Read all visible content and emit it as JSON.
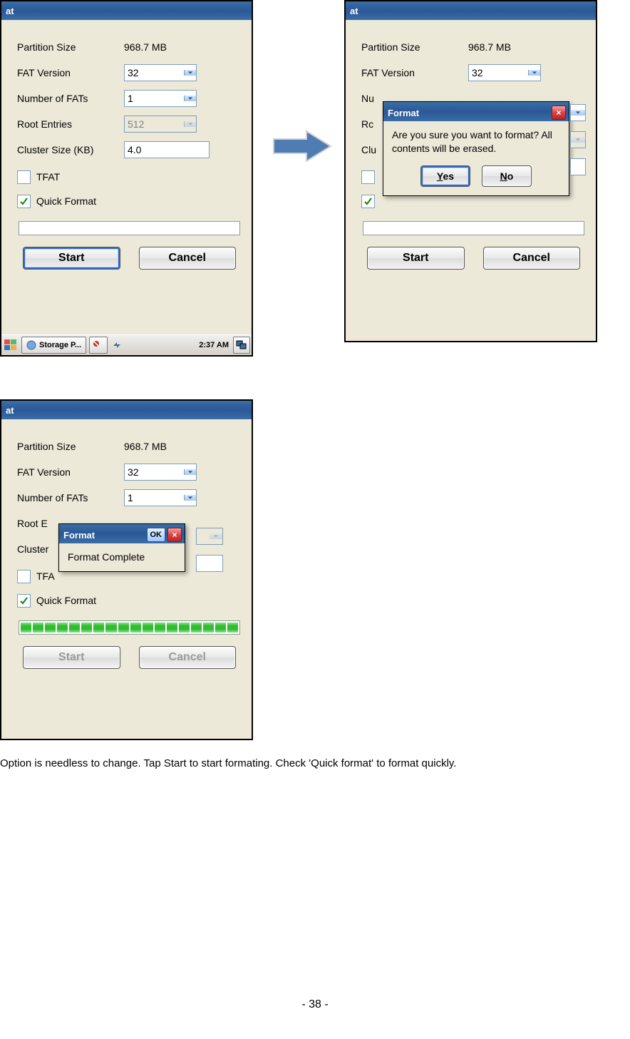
{
  "title_fragment": "at",
  "labels": {
    "partition_size": "Partition Size",
    "fat_version": "FAT Version",
    "num_fats": "Number of FATs",
    "root_entries": "Root Entries",
    "cluster_size": "Cluster Size (KB)",
    "tfat": "TFAT",
    "quick_format": "Quick Format"
  },
  "values": {
    "partition_size": "968.7 MB",
    "fat_version": "32",
    "num_fats": "1",
    "root_entries": "512",
    "cluster_size": "4.0"
  },
  "buttons": {
    "start": "Start",
    "cancel": "Cancel",
    "yes": "Yes",
    "no": "No",
    "ok": "OK"
  },
  "taskbar": {
    "item": "Storage P...",
    "time": "2:37 AM"
  },
  "dialogs": {
    "confirm_title": "Format",
    "confirm_msg": "Are you sure you want to format?  All contents will be erased.",
    "done_title": "Format",
    "done_msg": "Format Complete"
  },
  "p2": {
    "num_fats_trunc": "Nu",
    "root_trunc": "Rc",
    "cluster_trunc": "Clu"
  },
  "p3": {
    "root_trunc": "Root E",
    "cluster_trunc": "Cluster",
    "tfa_trunc": "TFA"
  },
  "caption": "Option is needless to change. Tap Start to start formating. Check 'Quick format' to format quickly.",
  "page_number": "- 38 -"
}
